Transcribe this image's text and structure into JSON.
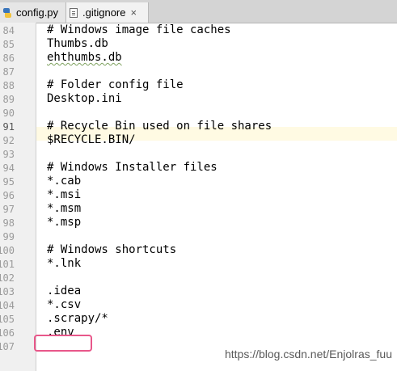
{
  "tabs": [
    {
      "label": "config.py",
      "icon": "python-file-icon"
    },
    {
      "label": ".gitignore",
      "icon": "text-file-icon",
      "close": "×",
      "active": true
    }
  ],
  "editor": {
    "current_line": "91",
    "lines": [
      {
        "num": "84",
        "text": "# Windows image file caches",
        "kind": "comment"
      },
      {
        "num": "85",
        "text": "Thumbs.db"
      },
      {
        "num": "86",
        "text": "ehthumbs.db",
        "squiggle": true
      },
      {
        "num": "87",
        "text": ""
      },
      {
        "num": "88",
        "text": "# Folder config file",
        "kind": "comment"
      },
      {
        "num": "89",
        "text": "Desktop.ini"
      },
      {
        "num": "90",
        "text": ""
      },
      {
        "num": "91",
        "text": "# Recycle Bin used on file shares",
        "kind": "comment"
      },
      {
        "num": "92",
        "text": "$RECYCLE.BIN/"
      },
      {
        "num": "93",
        "text": ""
      },
      {
        "num": "94",
        "text": "# Windows Installer files",
        "kind": "comment"
      },
      {
        "num": "95",
        "text": "*.cab"
      },
      {
        "num": "96",
        "text": "*.msi"
      },
      {
        "num": "97",
        "text": "*.msm"
      },
      {
        "num": "98",
        "text": "*.msp"
      },
      {
        "num": "99",
        "text": ""
      },
      {
        "num": "100",
        "text": "# Windows shortcuts",
        "kind": "comment"
      },
      {
        "num": "101",
        "text": "*.lnk"
      },
      {
        "num": "102",
        "text": ""
      },
      {
        "num": "103",
        "text": ".idea"
      },
      {
        "num": "104",
        "text": "*.csv"
      },
      {
        "num": "105",
        "text": ".scrapy/*"
      },
      {
        "num": "106",
        "text": ".env",
        "highlighted": true
      },
      {
        "num": "107",
        "text": ""
      }
    ]
  },
  "watermark": "https://blog.csdn.net/Enjolras_fuu",
  "colors": {
    "highlight_box": "#e8578a",
    "current_line_bg": "#fffae3"
  }
}
